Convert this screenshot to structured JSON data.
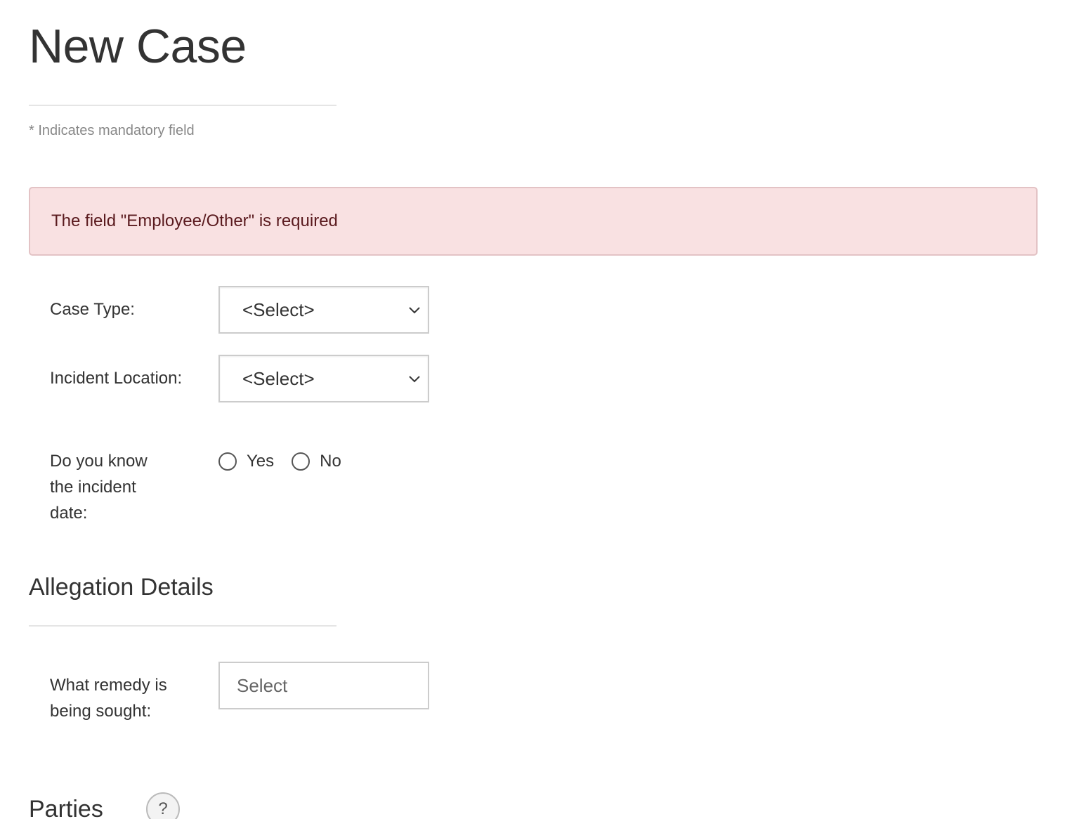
{
  "page": {
    "title": "New Case",
    "mandatory_note": "* Indicates mandatory field"
  },
  "alert": {
    "message": "The field \"Employee/Other\" is required",
    "colors": {
      "background": "#f9e1e2",
      "border": "#e3c3c5",
      "text": "#5a1a1e"
    }
  },
  "form": {
    "case_type": {
      "label": "Case Type:",
      "selected": "<Select>"
    },
    "incident_location": {
      "label": "Incident Location:",
      "selected": "<Select>"
    },
    "incident_date_known": {
      "label": "Do you know the incident date:",
      "options": [
        {
          "label": "Yes",
          "checked": false
        },
        {
          "label": "No",
          "checked": false
        }
      ]
    }
  },
  "allegation_details": {
    "heading": "Allegation Details",
    "remedy": {
      "label": "What remedy is being sought:",
      "placeholder": "Select"
    }
  },
  "parties": {
    "heading": "Parties",
    "help_label": "?"
  }
}
